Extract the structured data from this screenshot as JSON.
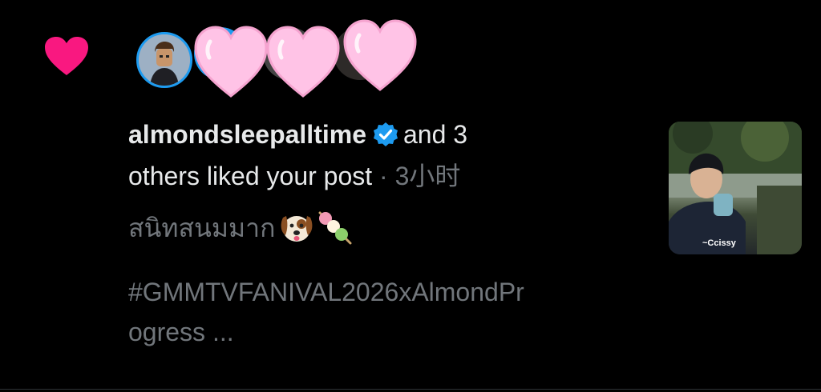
{
  "notification": {
    "type_icon": "heart-icon",
    "reaction_icon": "pink-heart-icon",
    "username": "almondsleepalltime",
    "verified_icon": "verified-badge-icon",
    "headline_rest_1": "and 3",
    "headline_rest_2": "others liked your post",
    "separator": "·",
    "timestamp": "3小时",
    "post_text_line1": "สนิทสนมมาก",
    "post_emoji_1": "dog-face-emoji",
    "post_emoji_2": "dango-emoji",
    "post_hashtag_line1": "#GMMTVFANIVAL2026xAlmondPr",
    "post_hashtag_line2": "ogress ...",
    "thumbnail_watermark": "~Ccissy",
    "colors": {
      "like_heart": "#f91880",
      "reaction_heart": "#ffc3e6",
      "verified": "#1d9bf0",
      "primary_text": "#e7e9ea",
      "secondary_text": "#71767b",
      "background": "#000000"
    }
  }
}
